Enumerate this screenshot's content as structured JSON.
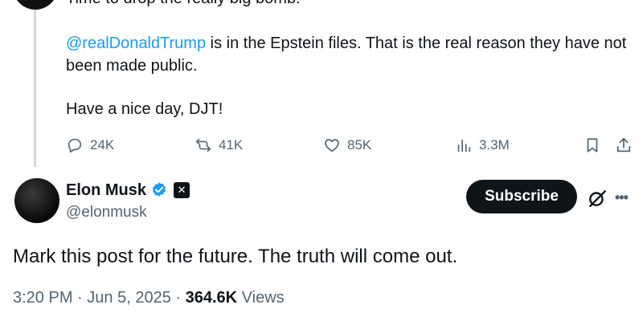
{
  "parent_post": {
    "clipped_line": "Time to drop the really big bomb:",
    "mention": "@realDonaldTrump",
    "para1_rest": " is in the Epstein files. That is the real reason they have not been made public.",
    "para2": "Have a nice day, DJT!",
    "actions": {
      "replies": "24K",
      "reposts": "41K",
      "likes": "85K",
      "views": "3.3M"
    }
  },
  "post": {
    "author_name": "Elon Musk",
    "author_handle": "@elonmusk",
    "subscribe_label": "Subscribe",
    "text": "Mark this post for the future. The truth will come out.",
    "time": "3:20 PM",
    "separator": "·",
    "date": "Jun 5, 2025",
    "views_count": "364.6K",
    "views_label": "Views"
  },
  "colors": {
    "accent": "#1d9bf0",
    "text": "#0f1419",
    "muted": "#536471",
    "thread_line": "#cfd9de"
  },
  "icons": {
    "reply": "reply-icon",
    "repost": "repost-icon",
    "like": "heart-icon",
    "views": "views-icon",
    "bookmark": "bookmark-icon",
    "share": "share-icon",
    "verified": "verified-badge-icon",
    "x_badge": "x-logo-icon",
    "grok": "grok-icon",
    "more": "more-icon"
  }
}
